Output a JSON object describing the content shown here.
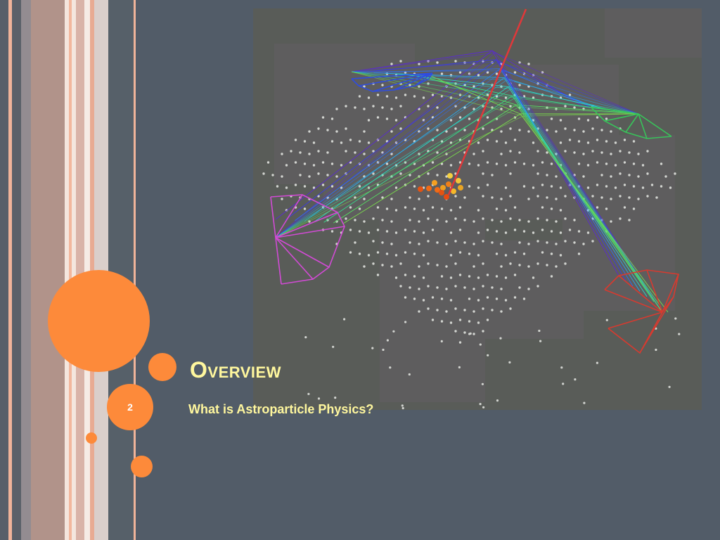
{
  "slide": {
    "title": "Overview",
    "subtitle": "What is Astroparticle Physics?",
    "number": "2"
  },
  "theme": {
    "background": "#525c68",
    "accent": "#fd8a3a",
    "title_color": "#fff79e"
  },
  "image": {
    "subject": "neutrino detector event display",
    "tracks": [
      "red muon track",
      "violet-blue-cyan-green Cherenkov light fans"
    ],
    "optical_module_clusters": [
      "blue",
      "green",
      "magenta",
      "red"
    ]
  }
}
